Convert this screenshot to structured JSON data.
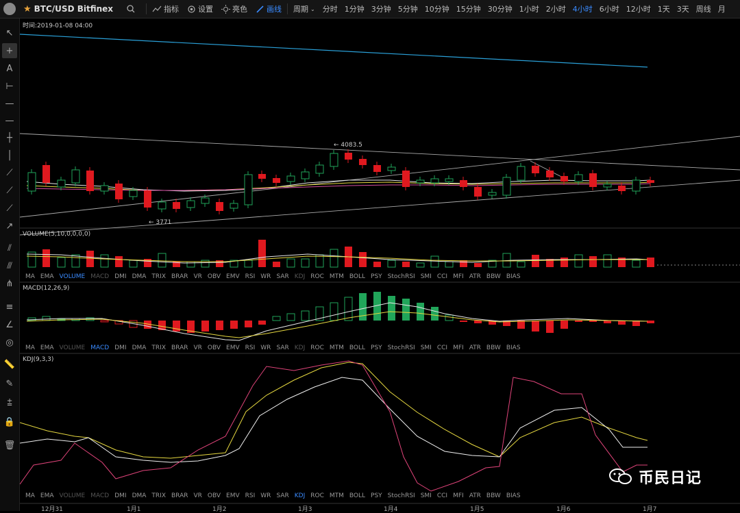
{
  "header": {
    "symbol": "BTC/USD Bitfinex",
    "indicators_label": "指标",
    "settings_label": "设置",
    "light_label": "亮色",
    "draw_label": "画线",
    "period_label": "周期",
    "timeframes": [
      "分时",
      "1分钟",
      "3分钟",
      "5分钟",
      "10分钟",
      "15分钟",
      "30分钟",
      "1小时",
      "2小时",
      "4小时",
      "6小时",
      "12小时",
      "1天",
      "3天",
      "周线",
      "月"
    ],
    "active_timeframe": "4小时"
  },
  "info": {
    "time_label": "时间:2019-01-08 04:00"
  },
  "price_annotations": {
    "high": "← 4083.5",
    "low": "← 3771"
  },
  "panels": {
    "volume_title": "VOLUME(5,10,0,0,0,0)",
    "macd_title": "MACD(12,26,9)",
    "kdj_title": "KDJ(9,3,3)"
  },
  "indicator_tabs": [
    "MA",
    "EMA",
    "VOLUME",
    "MACD",
    "DMI",
    "DMA",
    "TRIX",
    "BRAR",
    "VR",
    "OBV",
    "EMV",
    "RSI",
    "WR",
    "SAR",
    "KDJ",
    "ROC",
    "MTM",
    "BOLL",
    "PSY",
    "StochRSI",
    "SMI",
    "CCI",
    "MFI",
    "ATR",
    "BBW",
    "BIAS"
  ],
  "x_axis": [
    "12月31",
    "1月1",
    "1月2",
    "1月3",
    "1月4",
    "1月5",
    "1月6",
    "1月7"
  ],
  "watermark": "币民日记",
  "colors": {
    "up": "#21a55a",
    "down": "#e0191f",
    "accent": "#3a8bff",
    "background": "#000000"
  }
}
